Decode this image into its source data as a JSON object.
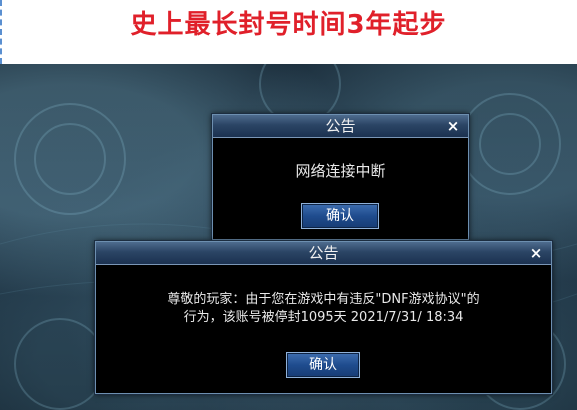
{
  "headline": "史上最长封号时间3年起步",
  "dialog_top": {
    "title": "公告",
    "close": "×",
    "message": "网络连接中断",
    "confirm_label": "确认"
  },
  "dialog_bottom": {
    "title": "公告",
    "close": "×",
    "message_line1": "尊敬的玩家：由于您在游戏中有违反\"DNF游戏协议\"的",
    "message_line2": "行为，该账号被停封1095天  2021/7/31/ 18:34",
    "confirm_label": "确认"
  },
  "colors": {
    "headline": "#e0202a",
    "dialog_border": "#6d8fb0",
    "button": "#1f4c8e"
  }
}
